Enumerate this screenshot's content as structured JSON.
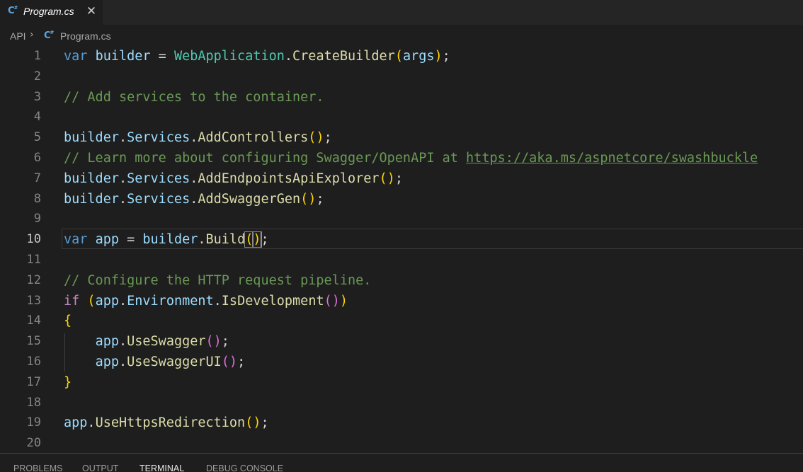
{
  "tab": {
    "label": "Program.cs",
    "close_glyph": "✕",
    "icon": "csharp-file-icon"
  },
  "breadcrumb": {
    "root": "API",
    "separator": "›",
    "file": "Program.cs",
    "file_icon": "csharp-file-icon"
  },
  "editor": {
    "active_line": 10,
    "lines": [
      {
        "n": "1",
        "text": "var builder = WebApplication.CreateBuilder(args);"
      },
      {
        "n": "2",
        "text": ""
      },
      {
        "n": "3",
        "text": "// Add services to the container."
      },
      {
        "n": "4",
        "text": ""
      },
      {
        "n": "5",
        "text": "builder.Services.AddControllers();"
      },
      {
        "n": "6",
        "text": "// Learn more about configuring Swagger/OpenAPI at https://aka.ms/aspnetcore/swashbuckle"
      },
      {
        "n": "7",
        "text": "builder.Services.AddEndpointsApiExplorer();"
      },
      {
        "n": "8",
        "text": "builder.Services.AddSwaggerGen();"
      },
      {
        "n": "9",
        "text": ""
      },
      {
        "n": "10",
        "text": "var app = builder.Build();"
      },
      {
        "n": "11",
        "text": ""
      },
      {
        "n": "12",
        "text": "// Configure the HTTP request pipeline."
      },
      {
        "n": "13",
        "text": "if (app.Environment.IsDevelopment())"
      },
      {
        "n": "14",
        "text": "{"
      },
      {
        "n": "15",
        "text": "    app.UseSwagger();"
      },
      {
        "n": "16",
        "text": "    app.UseSwaggerUI();"
      },
      {
        "n": "17",
        "text": "}"
      },
      {
        "n": "18",
        "text": ""
      },
      {
        "n": "19",
        "text": "app.UseHttpsRedirection();"
      },
      {
        "n": "20",
        "text": ""
      }
    ]
  },
  "panel": {
    "tabs": [
      {
        "label": "PROBLEMS",
        "active": false
      },
      {
        "label": "OUTPUT",
        "active": false
      },
      {
        "label": "TERMINAL",
        "active": true
      },
      {
        "label": "DEBUG CONSOLE",
        "active": false
      }
    ]
  },
  "colors": {
    "background": "#1e1e1e",
    "keyword": "#569cd6",
    "control_keyword": "#c586c0",
    "variable": "#9cdcfe",
    "type": "#4ec9b0",
    "function": "#dcdcaa",
    "comment": "#6a9955",
    "bracket_1": "#ffd700",
    "bracket_2": "#da70d6"
  }
}
